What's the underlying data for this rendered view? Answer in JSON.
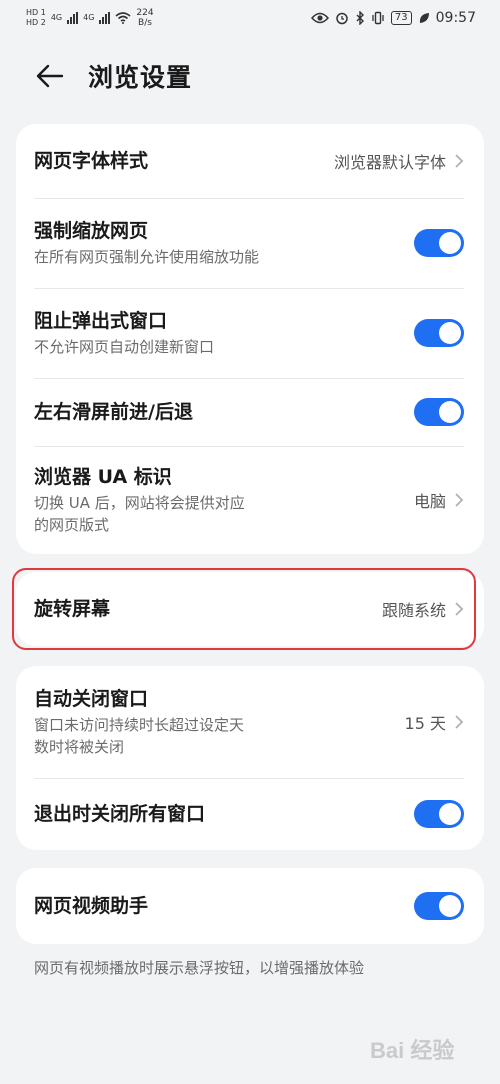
{
  "status_bar": {
    "sim1": "HD 1",
    "sim2": "HD 2",
    "net1": "4G",
    "net2": "4G",
    "speed_value": "224",
    "speed_unit": "B/s",
    "battery": "73",
    "time": "09:57"
  },
  "header": {
    "title": "浏览设置"
  },
  "group1": [
    {
      "title": "网页字体样式",
      "value": "浏览器默认字体",
      "type": "link"
    },
    {
      "title": "强制缩放网页",
      "subtitle": "在所有网页强制允许使用缩放功能",
      "type": "toggle",
      "on": true
    },
    {
      "title": "阻止弹出式窗口",
      "subtitle": "不允许网页自动创建新窗口",
      "type": "toggle",
      "on": true
    },
    {
      "title": "左右滑屏前进/后退",
      "type": "toggle",
      "on": true
    },
    {
      "title": "浏览器 UA 标识",
      "subtitle_line1": "切换 UA 后，网站将会提供对应",
      "subtitle_line2": "的网页版式",
      "value": "电脑",
      "type": "link"
    }
  ],
  "group2": {
    "title": "旋转屏幕",
    "value": "跟随系统"
  },
  "group3": [
    {
      "title": "自动关闭窗口",
      "subtitle_line1": "窗口未访问持续时长超过设定天",
      "subtitle_line2": "数时将被关闭",
      "value": "15 天",
      "type": "link"
    },
    {
      "title": "退出时关闭所有窗口",
      "type": "toggle",
      "on": true
    }
  ],
  "group4": {
    "title": "网页视频助手",
    "on": true
  },
  "footnote": "网页有视频播放时展示悬浮按钮，以增强播放体验",
  "watermark": "Bai 经验",
  "colors": {
    "accent": "#1f6ff2",
    "highlight": "#e0383e",
    "background": "#f1f3f5"
  }
}
